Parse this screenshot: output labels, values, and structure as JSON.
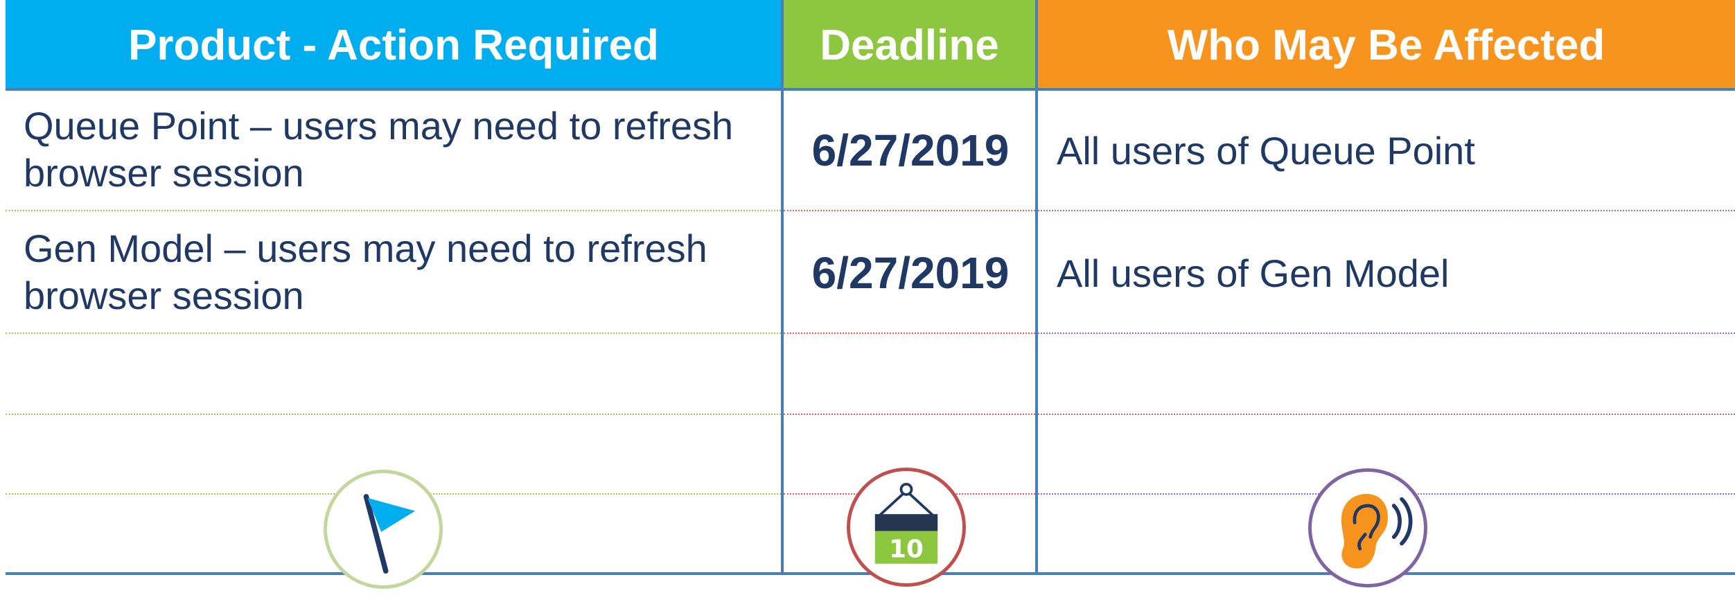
{
  "headers": {
    "product": "Product - Action Required",
    "deadline": "Deadline",
    "who": "Who May Be Affected"
  },
  "rows": [
    {
      "product": "Queue Point – users may need to refresh browser session",
      "deadline": "6/27/2019",
      "who": "All users of Queue Point"
    },
    {
      "product": "Gen Model – users may need to refresh browser session",
      "deadline": "6/27/2019",
      "who": "All users of Gen Model"
    }
  ],
  "icons": {
    "flag": "flag-icon",
    "calendar": "calendar-icon",
    "calendar_day": "10",
    "ear": "ear-listening-icon"
  },
  "colors": {
    "product_header": "#00AEEF",
    "deadline_header": "#8DC63F",
    "who_header": "#F7941D",
    "text": "#1F3864",
    "rule": "#4A7EBB"
  }
}
